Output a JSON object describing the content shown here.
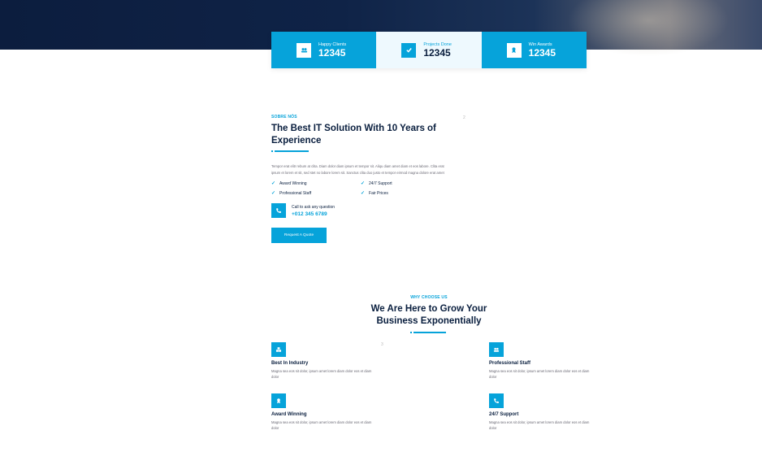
{
  "colors": {
    "accent": "#06a3da",
    "dark": "#091e3e",
    "hero": "#0c1d3e"
  },
  "stats": [
    {
      "icon": "users-icon",
      "label": "Happy Clients",
      "value": "12345"
    },
    {
      "icon": "check-icon",
      "label": "Projects Done",
      "value": "12345"
    },
    {
      "icon": "award-icon",
      "label": "Win Awards",
      "value": "12345"
    }
  ],
  "about": {
    "tag": "SOBRE NÓS",
    "title_line1": "The Best IT Solution With 10 Years of",
    "title_line2": "Experience",
    "paragraph": "Tempor erat elitr rebum at clita. Diam dolor diam ipsum et tempor sit. Aliqu diam amet diam et eos labore. Clita erat ipsum et lorem et sit, sed stet no labore lorem sit. Sanctus clita duo justo et tempor eirmod magna dolore erat amet",
    "checks": [
      "Award Winning",
      "24/7 Support",
      "Professional Staff",
      "Fair Prices"
    ],
    "call_label": "Call to ask any question",
    "phone": "+012 345 6789",
    "button": "Request A Quote",
    "broken_image": "2"
  },
  "why": {
    "tag": "WHY CHOOSE US",
    "title_line1": "We Are Here to Grow Your",
    "title_line2": "Business Exponentially",
    "broken_image": "3",
    "features": [
      {
        "icon": "cubes-icon",
        "title": "Best In Industry",
        "desc": "Magna sea eos sit dolor, ipsum amet lorem diam dolor eos et diam dolor"
      },
      {
        "icon": "award-icon",
        "title": "Award Winning",
        "desc": "Magna sea eos sit dolor, ipsum amet lorem diam dolor eos et diam dolor"
      },
      {
        "icon": "users-icon",
        "title": "Professional Staff",
        "desc": "Magna sea eos sit dolor, ipsum amet lorem diam dolor eos et diam dolor"
      },
      {
        "icon": "phone-icon",
        "title": "24/7 Support",
        "desc": "Magna sea eos sit dolor, ipsum amet lorem diam dolor eos et diam dolor"
      }
    ]
  }
}
